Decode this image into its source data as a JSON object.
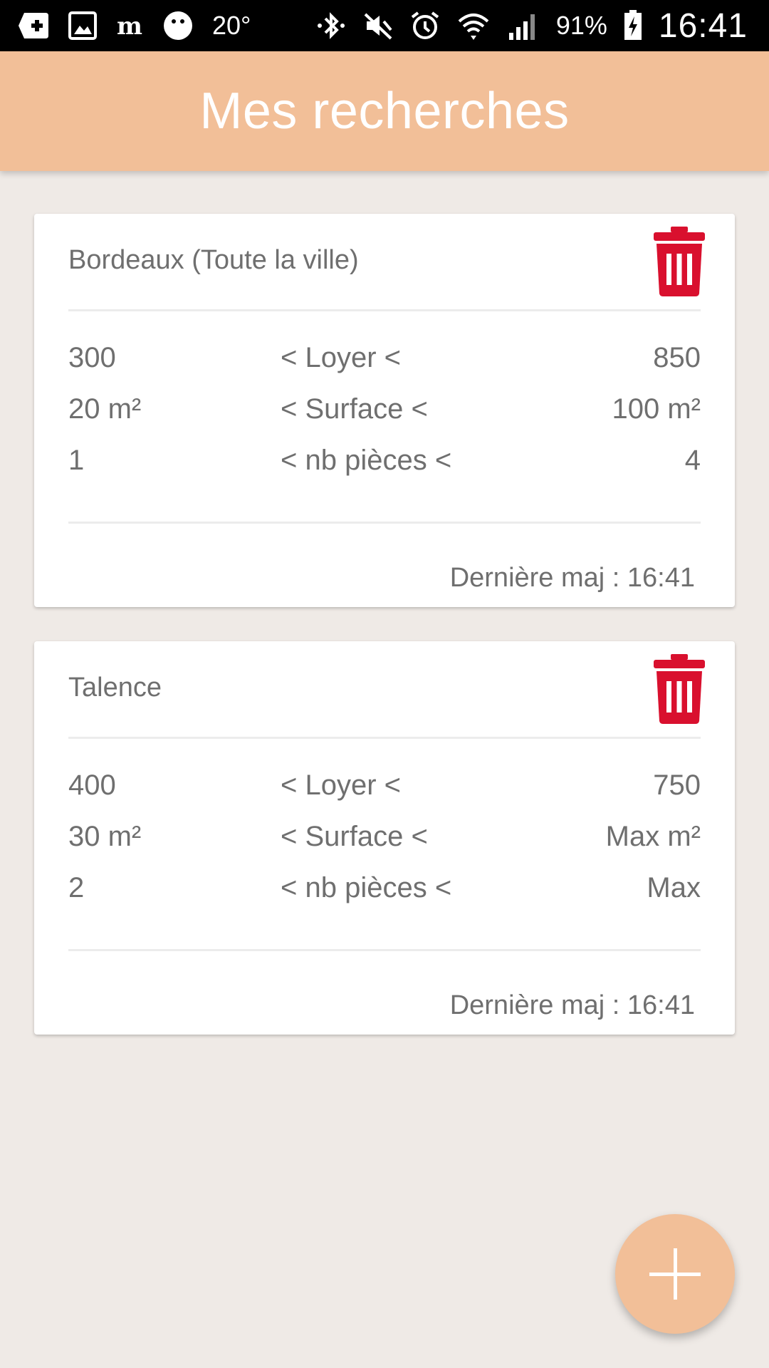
{
  "status_bar": {
    "temperature": "20°",
    "battery_percent": "91%",
    "time": "16:41",
    "left_icons": [
      "add-box-icon",
      "image-icon",
      "le-monde-icon",
      "weather-face-icon"
    ],
    "right_icons": [
      "bluetooth-icon",
      "mute-icon",
      "alarm-icon",
      "wifi-icon",
      "signal-icon",
      "battery-charging-icon"
    ]
  },
  "app_bar": {
    "title": "Mes recherches",
    "color": "#f2bf98"
  },
  "searches": [
    {
      "location": "Bordeaux (Toute la ville)",
      "criteria": [
        {
          "min": "300",
          "label": "< Loyer <",
          "max": "850"
        },
        {
          "min": "20 m²",
          "label": "< Surface <",
          "max": "100 m²"
        },
        {
          "min": "1",
          "label": "< nb pièces <",
          "max": "4"
        }
      ],
      "last_update": "Dernière maj : 16:41"
    },
    {
      "location": "Talence",
      "criteria": [
        {
          "min": "400",
          "label": "< Loyer <",
          "max": "750"
        },
        {
          "min": "30 m²",
          "label": "< Surface <",
          "max": "Max m²"
        },
        {
          "min": "2",
          "label": "< nb pièces <",
          "max": "Max"
        }
      ],
      "last_update": "Dernière maj : 16:41"
    }
  ],
  "colors": {
    "accent": "#f2bf98",
    "delete": "#d9102e",
    "background": "#efeae6",
    "text": "#6f6f6f"
  },
  "fab": {
    "icon": "plus-icon"
  }
}
